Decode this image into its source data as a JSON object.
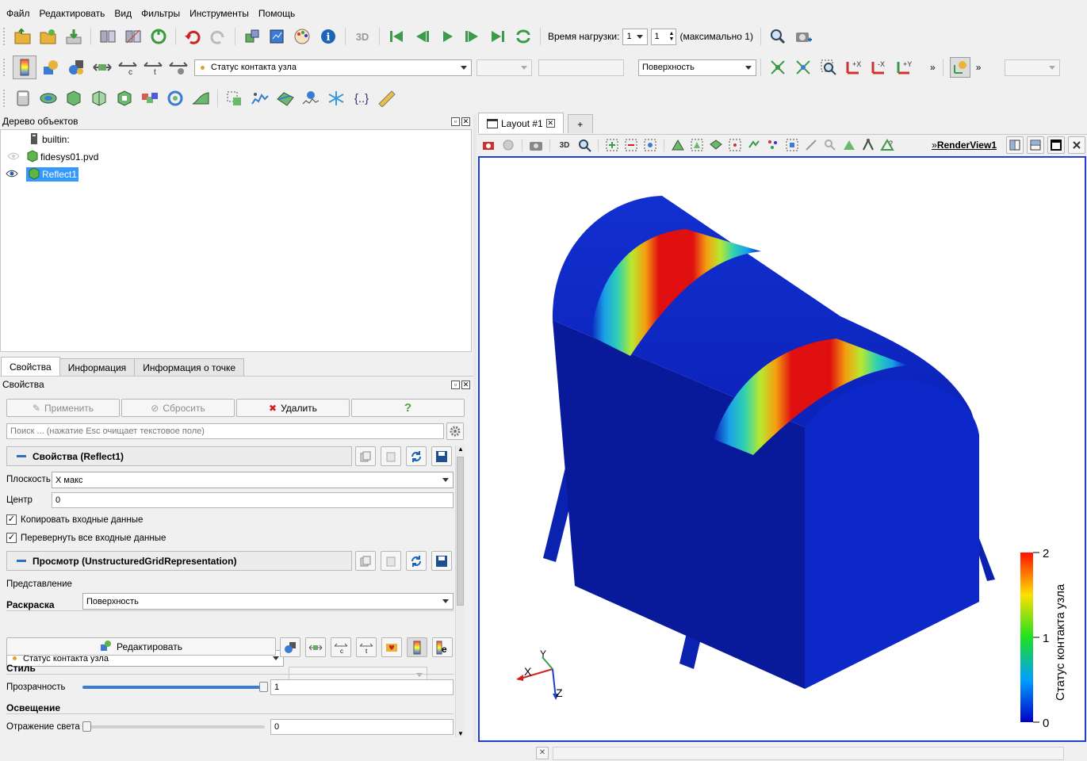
{
  "menu": [
    "Файл",
    "Редактировать",
    "Вид",
    "Фильтры",
    "Инструменты",
    "Помощь"
  ],
  "toolbar1": {
    "time_label": "Время нагрузки:",
    "time_value": "1",
    "time_step": "1",
    "time_max": "(максимально 1)",
    "icon_3d": "3D"
  },
  "toolbar2": {
    "color_by": "Статус контакта узла",
    "representation": "Поверхность",
    "more": "»",
    "more2": "»"
  },
  "pipeline": {
    "title": "Дерево объектов",
    "items": [
      {
        "label": "builtin:",
        "icon": "server-icon"
      },
      {
        "label": "fidesys01.pvd",
        "icon": "file-icon"
      },
      {
        "label": "Reflect1",
        "icon": "filter-icon",
        "selected": true
      }
    ]
  },
  "tabs": [
    "Свойства",
    "Информация",
    "Информация о точке"
  ],
  "properties": {
    "title": "Свойства",
    "apply": "Применить",
    "reset": "Сбросить",
    "delete": "Удалить",
    "help": "?",
    "search_placeholder": "Поиск ... (нажатие Esc очищает текстовое поле)",
    "section1": "Свойства (Reflect1)",
    "plane_label": "Плоскость",
    "plane_value": "X макс",
    "center_label": "Центр",
    "center_value": "0",
    "copy_input_label": "Копировать входные данные",
    "flip_all_label": "Перевернуть все входные данные",
    "section2": "Просмотр (UnstructuredGridRepresentation)",
    "representation_label": "Представление",
    "representation_value": "Поверхность",
    "coloring_title": "Раскраска",
    "coloring_value": "Статус контакта узла",
    "edit_button": "Редактировать",
    "style_title": "Стиль",
    "opacity_label": "Прозрачность",
    "opacity_value": "1",
    "lighting_title": "Освещение",
    "specular_label": "Отражение света",
    "specular_value": "0"
  },
  "layout": {
    "tab_label": "Layout #1",
    "add_tab": "+",
    "view_name": "RenderView1",
    "more": "»",
    "icon_3d": "3D"
  },
  "scalar_bar": {
    "title": "Статус контакта узла",
    "ticks": [
      "2",
      "1",
      "0"
    ]
  },
  "axes": {
    "x": "X",
    "y": "Y",
    "z": "Z"
  },
  "colors": {
    "selection": "#3399ff",
    "render_border": "#1f3fd1",
    "body_blue": "#0a1fb8"
  }
}
